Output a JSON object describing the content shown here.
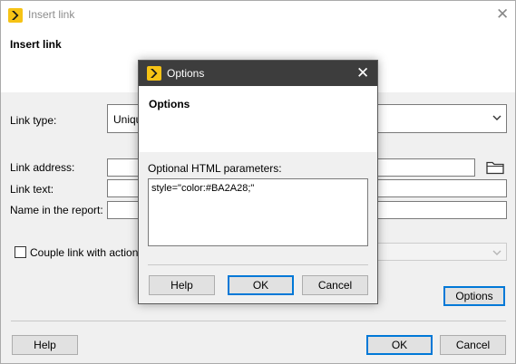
{
  "main_dialog": {
    "title": "Insert link",
    "header_title": "Insert link",
    "icons": {
      "app": "app-logo-icon",
      "close": "close-icon"
    },
    "fields": {
      "link_type": {
        "label": "Link type:",
        "value": "Uniqu"
      },
      "link_address": {
        "label": "Link address:",
        "value": ""
      },
      "link_text": {
        "label": "Link text:",
        "value": ""
      },
      "name_in_report": {
        "label": "Name in the report:",
        "value": ""
      },
      "couple_link": {
        "label": "Couple link with action:",
        "checked": false
      }
    },
    "folder_icon": "folder-icon",
    "buttons": {
      "options": "Options",
      "help": "Help",
      "ok": "OK",
      "cancel": "Cancel"
    }
  },
  "options_dialog": {
    "title": "Options",
    "header_title": "Options",
    "html_params_label": "Optional HTML parameters:",
    "html_params_value": "style=\"color:#BA2A28;\"",
    "icons": {
      "app": "app-logo-icon",
      "close": "close-icon"
    },
    "buttons": {
      "help": "Help",
      "ok": "OK",
      "cancel": "Cancel"
    }
  },
  "colors": {
    "accent_blue": "#0078d7",
    "title_bar_dark": "#3d3d3d",
    "logo_yellow": "#f6c315",
    "body_gray": "#f0f0f0"
  }
}
